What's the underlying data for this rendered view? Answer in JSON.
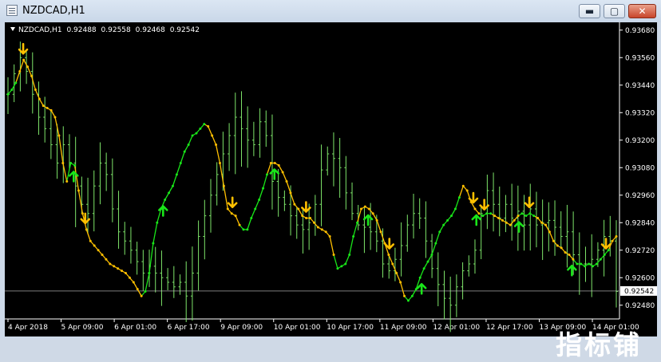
{
  "window": {
    "title": "NZDCAD,H1",
    "min_label": "▬",
    "max_label": "▢",
    "close_label": "✕"
  },
  "chart_header": {
    "symbol": "NZDCAD,H1",
    "open": "0.92488",
    "high": "0.92558",
    "low": "0.92468",
    "close": "0.92542"
  },
  "watermark": "指标铺",
  "colors": {
    "background": "#000000",
    "candle": "#7ee56a",
    "trend_up": "#19e619",
    "trend_down": "#ffc000",
    "axis_text": "#ffffff",
    "price_line": "#c8c8c8"
  },
  "chart_data": {
    "type": "bar",
    "symbol": "NZDCAD",
    "timeframe": "H1",
    "ylim": [
      0.9242,
      0.937
    ],
    "y_ticks": [
      "0.93680",
      "0.93560",
      "0.93440",
      "0.93320",
      "0.93200",
      "0.93080",
      "0.92960",
      "0.92840",
      "0.92720",
      "0.92600",
      "0.92480"
    ],
    "x_ticks": [
      "4 Apr 2018",
      "5 Apr 09:00",
      "6 Apr 01:00",
      "6 Apr 17:00",
      "9 Apr 09:00",
      "10 Apr 01:00",
      "10 Apr 17:00",
      "11 Apr 09:00",
      "12 Apr 01:00",
      "12 Apr 17:00",
      "13 Apr 09:00",
      "14 Apr 01:00"
    ],
    "current_price": "0.92542",
    "closes": [
      0.934,
      0.9349,
      0.9356,
      0.935,
      0.934,
      0.933,
      0.9325,
      0.9318,
      0.931,
      0.9318,
      0.931,
      0.93,
      0.9292,
      0.9288,
      0.93,
      0.931,
      0.9305,
      0.929,
      0.928,
      0.9276,
      0.9272,
      0.9267,
      0.9262,
      0.9265,
      0.9262,
      0.926,
      0.9258,
      0.9256,
      0.9258,
      0.9252,
      0.9262,
      0.9278,
      0.9287,
      0.9296,
      0.9305,
      0.9314,
      0.9322,
      0.933,
      0.9325,
      0.932,
      0.9318,
      0.9328,
      0.9322,
      0.9302,
      0.9295,
      0.9292,
      0.9287,
      0.9283,
      0.9281,
      0.9284,
      0.9292,
      0.9307,
      0.9314,
      0.9312,
      0.9308,
      0.9297,
      0.9288,
      0.9283,
      0.9282,
      0.928,
      0.9276,
      0.9266,
      0.9263,
      0.9268,
      0.9274,
      0.9283,
      0.9288,
      0.9286,
      0.9276,
      0.9264,
      0.9257,
      0.9251,
      0.9248,
      0.9256,
      0.9263,
      0.9266,
      0.9272,
      0.9288,
      0.9298,
      0.9292,
      0.9286,
      0.9292,
      0.9286,
      0.9289,
      0.9283,
      0.929,
      0.9283,
      0.9284,
      0.9285,
      0.9282,
      0.9278,
      0.928,
      0.927,
      0.9266,
      0.9266,
      0.9268,
      0.9272,
      0.9278,
      0.9276,
      0.9254
    ],
    "trend": {
      "values": [
        0.934,
        0.9342,
        0.9345,
        0.935,
        0.9355,
        0.9352,
        0.9348,
        0.9342,
        0.9338,
        0.9335,
        0.9334,
        0.9333,
        0.933,
        0.9322,
        0.931,
        0.9302,
        0.931,
        0.9309,
        0.9298,
        0.9288,
        0.9281,
        0.9276,
        0.9274,
        0.9272,
        0.927,
        0.9268,
        0.9266,
        0.9265,
        0.9264,
        0.9263,
        0.9262,
        0.926,
        0.9258,
        0.9255,
        0.9252,
        0.9254,
        0.9262,
        0.9275,
        0.9284,
        0.929,
        0.9294,
        0.9297,
        0.93,
        0.9305,
        0.931,
        0.9315,
        0.9318,
        0.9322,
        0.9323,
        0.9325,
        0.9327,
        0.9326,
        0.9322,
        0.9318,
        0.931,
        0.93,
        0.929,
        0.9288,
        0.9287,
        0.9283,
        0.9281,
        0.9281,
        0.9286,
        0.929,
        0.9294,
        0.9299,
        0.9305,
        0.931,
        0.931,
        0.9309,
        0.9306,
        0.9302,
        0.9297,
        0.9292,
        0.929,
        0.9287,
        0.9286,
        0.9286,
        0.9284,
        0.9282,
        0.9281,
        0.928,
        0.9278,
        0.927,
        0.9264,
        0.9265,
        0.9266,
        0.927,
        0.9278,
        0.9284,
        0.929,
        0.9291,
        0.929,
        0.9288,
        0.9285,
        0.928,
        0.9275,
        0.927,
        0.9266,
        0.9262,
        0.9258,
        0.9252,
        0.925,
        0.9252,
        0.9255,
        0.926,
        0.9264,
        0.9267,
        0.927,
        0.9275,
        0.928,
        0.9283,
        0.9285,
        0.9287,
        0.929,
        0.9295,
        0.93,
        0.9298,
        0.9293,
        0.929,
        0.9288,
        0.9287,
        0.9288,
        0.9288,
        0.9287,
        0.9286,
        0.9285,
        0.9284,
        0.9283,
        0.9285,
        0.9287,
        0.9288,
        0.9287,
        0.9288,
        0.9287,
        0.9286,
        0.9284,
        0.9283,
        0.928,
        0.9276,
        0.9274,
        0.9273,
        0.9271,
        0.927,
        0.9268,
        0.9266,
        0.9266,
        0.9265,
        0.9266,
        0.9265,
        0.9266,
        0.9268,
        0.927,
        0.9272,
        0.9276,
        0.9278
      ],
      "direction": [
        "up",
        "up",
        "up",
        "down",
        "down",
        "down",
        "down",
        "down",
        "down",
        "down",
        "down",
        "down",
        "down",
        "down",
        "down",
        "down",
        "up",
        "up",
        "down",
        "down",
        "down",
        "down",
        "down",
        "down",
        "down",
        "down",
        "down",
        "down",
        "down",
        "down",
        "down",
        "down",
        "down",
        "down",
        "down",
        "up",
        "up",
        "up",
        "up",
        "up",
        "up",
        "up",
        "up",
        "up",
        "up",
        "up",
        "up",
        "up",
        "up",
        "up",
        "up",
        "down",
        "down",
        "down",
        "down",
        "down",
        "down",
        "down",
        "down",
        "down",
        "up",
        "up",
        "up",
        "up",
        "up",
        "up",
        "up",
        "down",
        "down",
        "down",
        "down",
        "down",
        "down",
        "down",
        "down",
        "down",
        "down",
        "down",
        "down",
        "down",
        "down",
        "down",
        "down",
        "down",
        "up",
        "up",
        "up",
        "up",
        "up",
        "up",
        "down",
        "down",
        "down",
        "down",
        "down",
        "down",
        "down",
        "down",
        "down",
        "down",
        "down",
        "down",
        "up",
        "up",
        "up",
        "up",
        "up",
        "up",
        "up",
        "up",
        "up",
        "up",
        "up",
        "up",
        "up",
        "up",
        "down",
        "down",
        "down",
        "down",
        "down",
        "up",
        "up",
        "up",
        "down",
        "down",
        "down",
        "down",
        "down",
        "down",
        "down",
        "up",
        "up",
        "up",
        "up",
        "down",
        "down",
        "down",
        "down",
        "down",
        "down",
        "down",
        "down",
        "down",
        "down",
        "up",
        "up",
        "up",
        "up",
        "up",
        "up",
        "up",
        "up",
        "up"
      ]
    },
    "signals": [
      {
        "type": "sell",
        "x": 0.025
      },
      {
        "type": "buy",
        "x": 0.108
      },
      {
        "type": "sell",
        "x": 0.127
      },
      {
        "type": "buy",
        "x": 0.255
      },
      {
        "type": "sell",
        "x": 0.369
      },
      {
        "type": "buy",
        "x": 0.438
      },
      {
        "type": "sell",
        "x": 0.49
      },
      {
        "type": "buy",
        "x": 0.592
      },
      {
        "type": "sell",
        "x": 0.627
      },
      {
        "type": "buy",
        "x": 0.68
      },
      {
        "type": "sell",
        "x": 0.765
      },
      {
        "type": "buy",
        "x": 0.77
      },
      {
        "type": "sell",
        "x": 0.783
      },
      {
        "type": "buy",
        "x": 0.84
      },
      {
        "type": "sell",
        "x": 0.857
      },
      {
        "type": "buy",
        "x": 0.927
      },
      {
        "type": "sell",
        "x": 0.983
      }
    ]
  }
}
